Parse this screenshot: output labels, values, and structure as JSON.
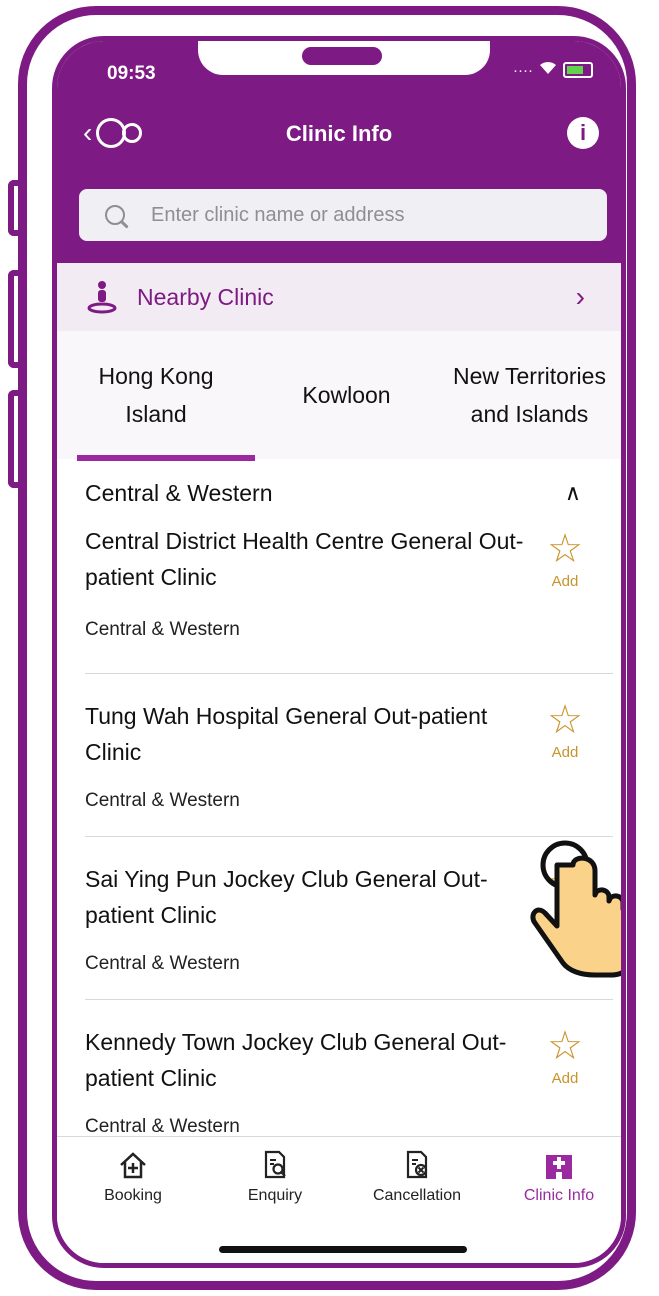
{
  "status_bar": {
    "time": "09:53"
  },
  "nav": {
    "title": "Clinic Info",
    "info_label": "i"
  },
  "search": {
    "placeholder": "Enter clinic name or address"
  },
  "nearby": {
    "label": "Nearby Clinic"
  },
  "tabs": [
    {
      "label": "Hong Kong Island",
      "active": true
    },
    {
      "label": "Kowloon",
      "active": false
    },
    {
      "label": "New Territories and Islands",
      "active": false
    }
  ],
  "district": {
    "name": "Central & Western"
  },
  "clinics": [
    {
      "name": "Central District Health Centre General Out-patient Clinic",
      "district": "Central & Western",
      "fav_label": "Add"
    },
    {
      "name": "Tung Wah Hospital General Out-patient Clinic",
      "district": "Central & Western",
      "fav_label": "Add"
    },
    {
      "name": "Sai Ying Pun Jockey Club General Out-patient Clinic",
      "district": "Central & Western",
      "fav_label": ""
    },
    {
      "name": "Kennedy Town Jockey Club General Out-patient Clinic",
      "district": "Central & Western",
      "fav_label": "Add"
    }
  ],
  "tabbar": [
    {
      "label": "Booking",
      "icon": "house-plus-icon"
    },
    {
      "label": "Enquiry",
      "icon": "document-search-icon"
    },
    {
      "label": "Cancellation",
      "icon": "document-cancel-icon"
    },
    {
      "label": "Clinic Info",
      "icon": "hospital-icon",
      "active": true
    }
  ],
  "colors": {
    "brand": "#7d1a83",
    "accent": "#9b2aa1",
    "star": "#c9932a"
  }
}
